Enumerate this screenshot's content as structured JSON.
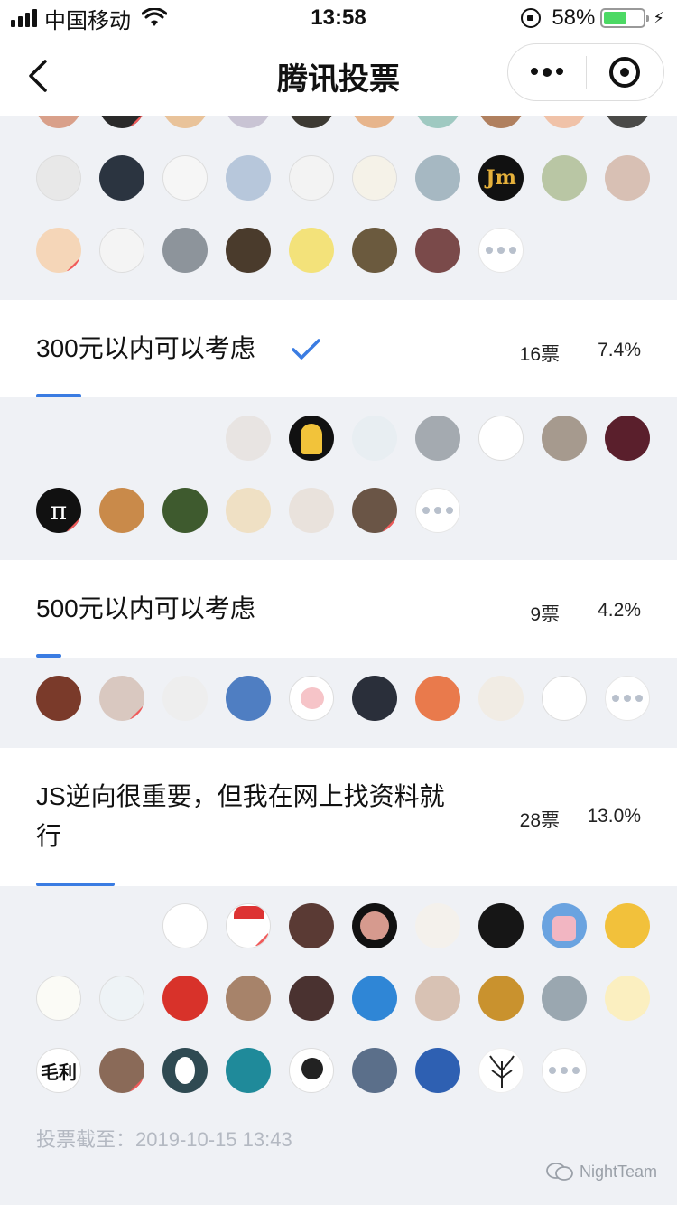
{
  "status_bar": {
    "carrier": "中国移动",
    "time": "13:58",
    "battery_text": "58%",
    "battery_level": 0.58
  },
  "nav": {
    "title": "腾讯投票",
    "back_icon": "chevron-left-icon",
    "more_icon": "more-dots-icon",
    "close_icon": "target-icon"
  },
  "options": [
    {
      "label": "300元以内可以考虑",
      "votes": "16票",
      "percent": "7.4%",
      "checked": true,
      "share": 0.074
    },
    {
      "label": "500元以内可以考虑",
      "votes": "9票",
      "percent": "4.2%",
      "checked": false,
      "share": 0.042
    },
    {
      "label": "JS逆向很重要，但我在网上找资料就行",
      "votes": "28票",
      "percent": "13.0%",
      "checked": false,
      "share": 0.13
    }
  ],
  "avatar_text": "毛利",
  "deadline": "投票截至：2019-10-15 13:43",
  "watermark": "NightTeam",
  "colors": {
    "accent": "#3a7ce2",
    "background": "#eff1f5",
    "battery": "#4cd964"
  }
}
